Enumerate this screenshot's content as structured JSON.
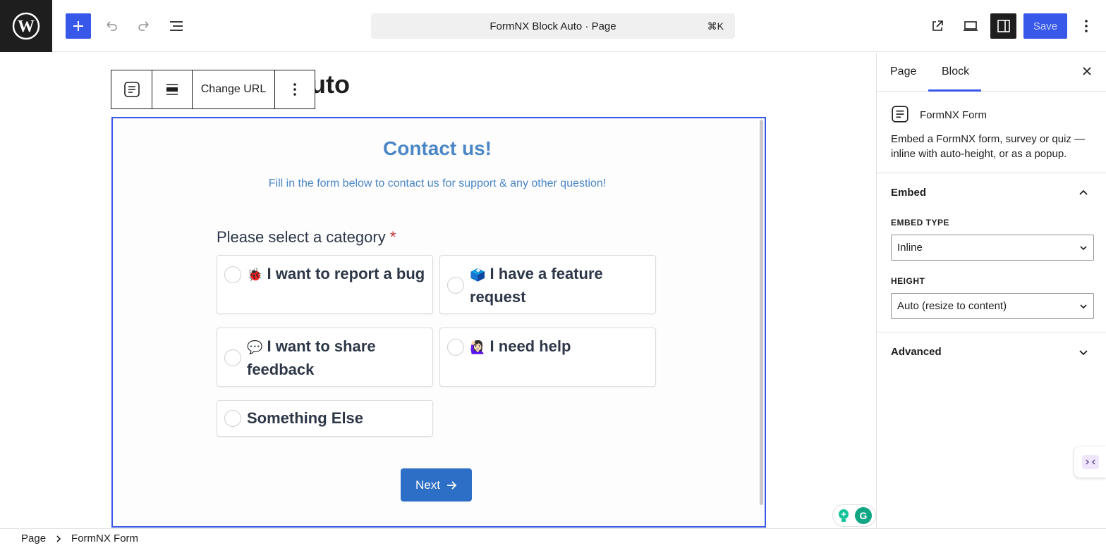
{
  "topbar": {
    "document_title": "FormNX Block Auto · Page",
    "shortcut": "⌘K",
    "save_label": "Save"
  },
  "canvas": {
    "page_title_visible_fragment": "uto",
    "block_toolbar": {
      "change_url_label": "Change URL"
    }
  },
  "form": {
    "title": "Contact us!",
    "subtitle": "Fill in the form below to contact us for support & any other question!",
    "question": "Please select a category",
    "required_mark": "*",
    "options": [
      {
        "emoji": "🐞",
        "label": "I want to report a bug"
      },
      {
        "emoji": "🗳️",
        "label": "I have a feature request"
      },
      {
        "emoji": "💬",
        "label": "I want to share feedback"
      },
      {
        "emoji": "🙋🏻‍♀️",
        "label": "I need help"
      },
      {
        "emoji": "",
        "label": "Something Else"
      }
    ],
    "next_label": "Next"
  },
  "panel": {
    "tabs": [
      "Page",
      "Block"
    ],
    "active_tab": "Block",
    "block_name": "FormNX Form",
    "block_description": "Embed a FormNX form, survey or quiz — inline with auto-height, or as a popup.",
    "embed_section": "Embed",
    "embed_type_label": "EMBED TYPE",
    "embed_type_value": "Inline",
    "height_label": "HEIGHT",
    "height_value": "Auto (resize to content)",
    "advanced_section": "Advanced"
  },
  "breadcrumb": [
    "Page",
    "FormNX Form"
  ],
  "colors": {
    "accent": "#3858e9",
    "form_blue": "#4a86c5",
    "next_button": "#2d6fc6"
  }
}
